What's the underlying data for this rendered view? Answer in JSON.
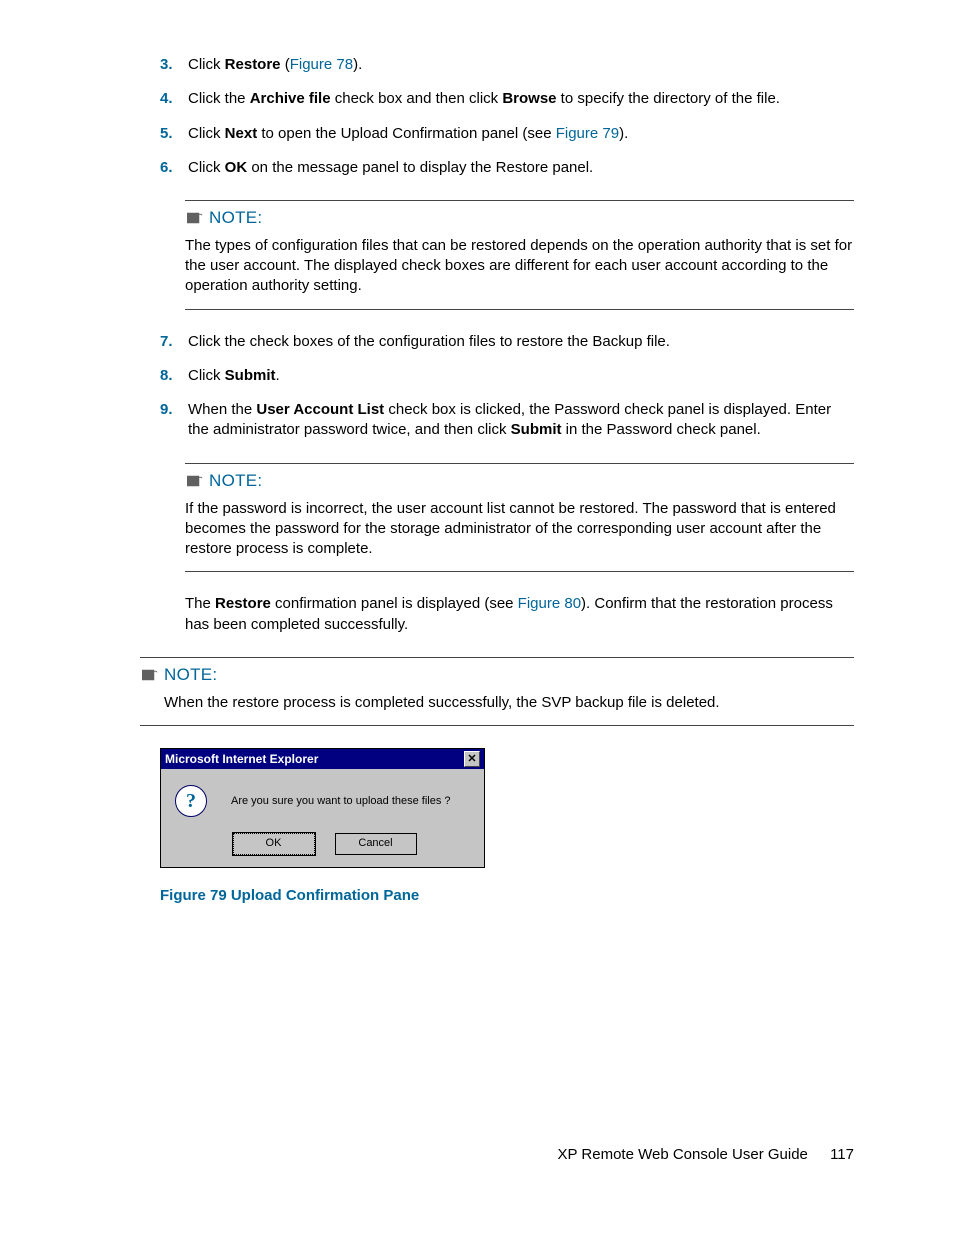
{
  "steps_a": [
    {
      "num": "3.",
      "pre": "Click ",
      "b1": "Restore",
      "post1": " (",
      "link": "Figure 78",
      "post2": ")."
    },
    {
      "num": "4.",
      "pre": "Click the ",
      "b1": "Archive file",
      "mid": " check box and then click ",
      "b2": "Browse",
      "post": " to specify the directory of the file."
    },
    {
      "num": "5.",
      "pre": "Click ",
      "b1": "Next",
      "mid": " to open the Upload Confirmation panel (see ",
      "link": "Figure 79",
      "post": ")."
    },
    {
      "num": "6.",
      "pre": "Click ",
      "b1": "OK",
      "post": " on the message panel to display the Restore panel."
    }
  ],
  "note1_label": "NOTE:",
  "note1_body": "The types of configuration files that can be restored depends on the operation authority that is set for the user account. The displayed check boxes are different for each user account according to the operation authority setting.",
  "steps_b": [
    {
      "num": "7.",
      "text": "Click the check boxes of the configuration files to restore the Backup file."
    },
    {
      "num": "8.",
      "pre": "Click ",
      "b1": "Submit",
      "post": "."
    },
    {
      "num": "9.",
      "pre": "When the ",
      "b1": "User Account List",
      "mid": " check box is clicked, the Password check panel is displayed. Enter the administrator password twice, and then click ",
      "b2": "Submit",
      "post": " in the Password check panel."
    }
  ],
  "note2_label": "NOTE:",
  "note2_body": "If the password is incorrect, the user account list cannot be restored. The password that is entered becomes the password for the storage administrator of the corresponding user account after the restore process is complete.",
  "restore_para_pre": "The ",
  "restore_para_b": "Restore",
  "restore_para_mid": " confirmation panel is displayed (see ",
  "restore_para_link": "Figure 80",
  "restore_para_post": "). Confirm that the restoration process has been completed successfully.",
  "note3_label": "NOTE:",
  "note3_body": "When the restore process is completed successfully, the SVP backup file is deleted.",
  "dialog": {
    "title": "Microsoft Internet Explorer",
    "message": "Are you sure you want to upload these files ?",
    "ok": "OK",
    "cancel": "Cancel",
    "close_glyph": "✕",
    "q": "?"
  },
  "figure_caption": "Figure 79 Upload Confirmation Pane",
  "footer_text": "XP Remote Web Console User Guide",
  "page_number": "117"
}
